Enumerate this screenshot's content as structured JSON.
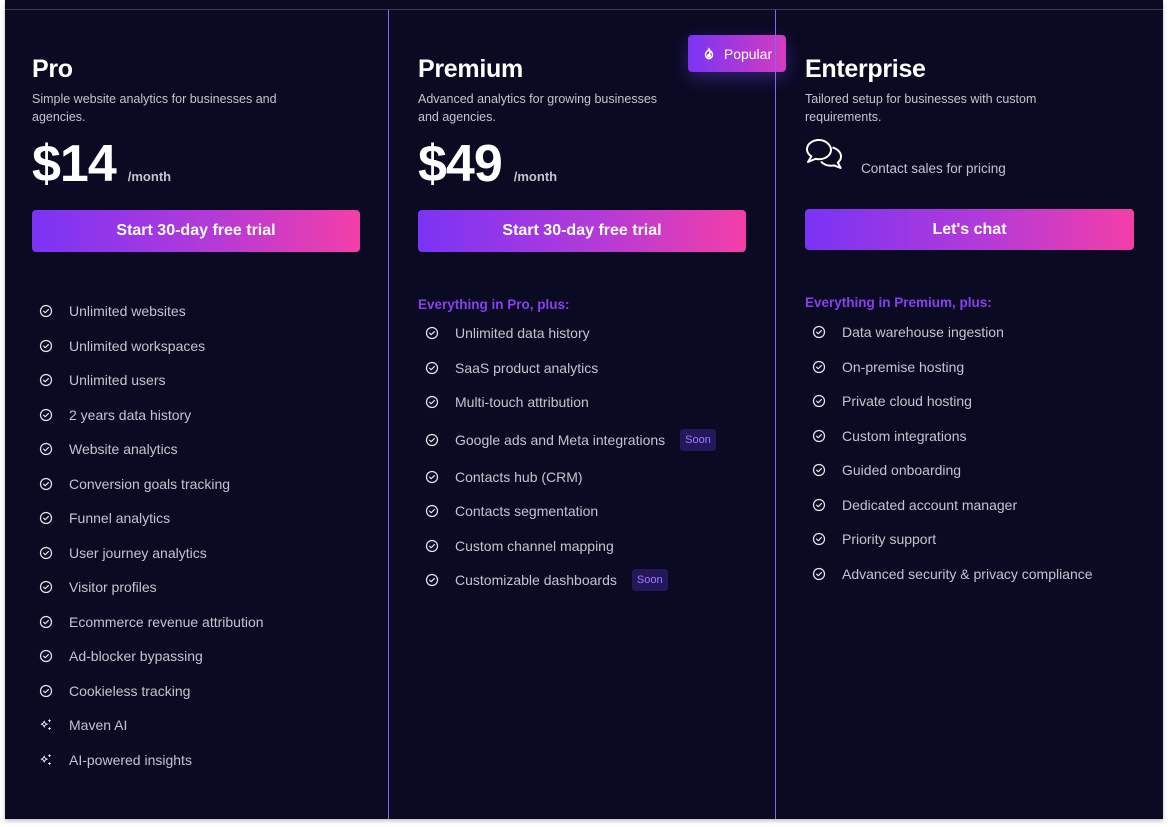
{
  "colors": {
    "background": "#0a0a22",
    "divider": "#7c6cf0",
    "accent_start": "#7a34f5",
    "accent_end": "#f43ea8",
    "subhead": "#8a3ff0",
    "badge_bg": "#25185a",
    "badge_text": "#9c7cff"
  },
  "plans": [
    {
      "name": "Pro",
      "description": "Simple website analytics for businesses and agencies.",
      "price": "$14",
      "period": "/month",
      "cta_label": "Start 30-day free trial",
      "features": [
        {
          "label": "Unlimited websites",
          "icon": "check-circle-icon"
        },
        {
          "label": "Unlimited workspaces",
          "icon": "check-circle-icon"
        },
        {
          "label": "Unlimited users",
          "icon": "check-circle-icon"
        },
        {
          "label": "2 years data history",
          "icon": "check-circle-icon"
        },
        {
          "label": "Website analytics",
          "icon": "check-circle-icon"
        },
        {
          "label": "Conversion goals tracking",
          "icon": "check-circle-icon"
        },
        {
          "label": "Funnel analytics",
          "icon": "check-circle-icon"
        },
        {
          "label": "User journey analytics",
          "icon": "check-circle-icon"
        },
        {
          "label": "Visitor profiles",
          "icon": "check-circle-icon"
        },
        {
          "label": "Ecommerce revenue attribution",
          "icon": "check-circle-icon"
        },
        {
          "label": "Ad-blocker bypassing",
          "icon": "check-circle-icon"
        },
        {
          "label": "Cookieless tracking",
          "icon": "check-circle-icon"
        },
        {
          "label": "Maven AI",
          "icon": "sparkles-icon"
        },
        {
          "label": "AI-powered insights",
          "icon": "sparkles-icon"
        }
      ]
    },
    {
      "name": "Premium",
      "description": "Advanced analytics for growing businesses and agencies.",
      "price": "$49",
      "period": "/month",
      "badge_label": "Popular",
      "badge_icon": "flame-icon",
      "cta_label": "Start 30-day free trial",
      "subhead": "Everything in Pro, plus:",
      "features": [
        {
          "label": "Unlimited data history",
          "icon": "check-circle-icon"
        },
        {
          "label": "SaaS product analytics",
          "icon": "check-circle-icon"
        },
        {
          "label": "Multi-touch attribution",
          "icon": "check-circle-icon"
        },
        {
          "label": "Google ads and Meta integrations",
          "icon": "check-circle-icon",
          "tag": "Soon"
        },
        {
          "label": "Contacts hub (CRM)",
          "icon": "check-circle-icon"
        },
        {
          "label": "Contacts segmentation",
          "icon": "check-circle-icon"
        },
        {
          "label": "Custom channel mapping",
          "icon": "check-circle-icon"
        },
        {
          "label": "Customizable dashboards",
          "icon": "check-circle-icon",
          "tag": "Soon"
        }
      ]
    },
    {
      "name": "Enterprise",
      "description": "Tailored setup for businesses with custom requirements.",
      "contact_icon": "chat-bubbles-icon",
      "contact_text": "Contact sales for pricing",
      "cta_label": "Let's chat",
      "subhead": "Everything in Premium, plus:",
      "features": [
        {
          "label": "Data warehouse ingestion",
          "icon": "check-circle-icon"
        },
        {
          "label": "On-premise hosting",
          "icon": "check-circle-icon"
        },
        {
          "label": "Private cloud hosting",
          "icon": "check-circle-icon"
        },
        {
          "label": "Custom integrations",
          "icon": "check-circle-icon"
        },
        {
          "label": "Guided onboarding",
          "icon": "check-circle-icon"
        },
        {
          "label": "Dedicated account manager",
          "icon": "check-circle-icon"
        },
        {
          "label": "Priority support",
          "icon": "check-circle-icon"
        },
        {
          "label": "Advanced security & privacy compliance",
          "icon": "check-circle-icon"
        }
      ]
    }
  ]
}
